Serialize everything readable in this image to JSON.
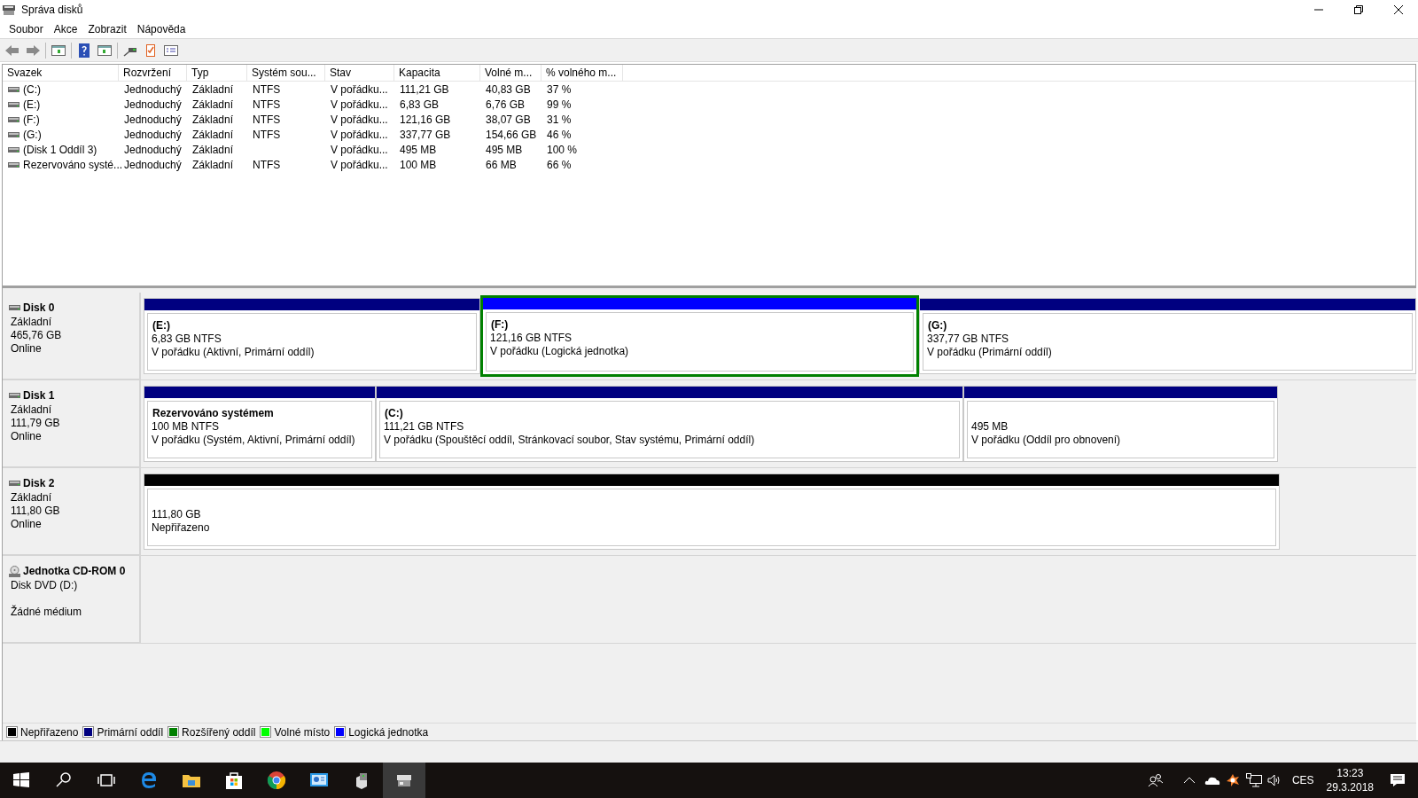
{
  "window": {
    "title": "Správa disků"
  },
  "menu": [
    "Soubor",
    "Akce",
    "Zobrazit",
    "Nápověda"
  ],
  "volume_table": {
    "columns": [
      "Svazek",
      "Rozvržení",
      "Typ",
      "Systém sou...",
      "Stav",
      "Kapacita",
      "Volné m...",
      "% volného m..."
    ],
    "rows": [
      [
        "(C:)",
        "Jednoduchý",
        "Základní",
        "NTFS",
        "V pořádku...",
        "111,21 GB",
        "40,83 GB",
        "37 %"
      ],
      [
        "(E:)",
        "Jednoduchý",
        "Základní",
        "NTFS",
        "V pořádku...",
        "6,83 GB",
        "6,76 GB",
        "99 %"
      ],
      [
        "(F:)",
        "Jednoduchý",
        "Základní",
        "NTFS",
        "V pořádku...",
        "121,16 GB",
        "38,07 GB",
        "31 %"
      ],
      [
        "(G:)",
        "Jednoduchý",
        "Základní",
        "NTFS",
        "V pořádku...",
        "337,77 GB",
        "154,66 GB",
        "46 %"
      ],
      [
        "(Disk 1 Oddíl 3)",
        "Jednoduchý",
        "Základní",
        "",
        "V pořádku...",
        "495 MB",
        "495 MB",
        "100 %"
      ],
      [
        "Rezervováno systé...",
        "Jednoduchý",
        "Základní",
        "NTFS",
        "V pořádku...",
        "100 MB",
        "66 MB",
        "66 %"
      ]
    ]
  },
  "disks": [
    {
      "name": "Disk 0",
      "kind": "disk",
      "lines": [
        "Základní",
        "465,76 GB",
        "Online"
      ],
      "partitions": [
        {
          "kind": "primary",
          "selected": false,
          "title": "(E:)",
          "lines": [
            "6,83 GB NTFS",
            "V pořádku (Aktivní, Primární oddíl)"
          ]
        },
        {
          "kind": "logical",
          "selected": true,
          "title": "(F:)",
          "lines": [
            "121,16 GB NTFS",
            "V pořádku (Logická jednotka)"
          ]
        },
        {
          "kind": "primary",
          "selected": false,
          "title": "(G:)",
          "lines": [
            "337,77 GB NTFS",
            "V pořádku (Primární oddíl)"
          ]
        }
      ]
    },
    {
      "name": "Disk 1",
      "kind": "disk",
      "lines": [
        "Základní",
        "111,79 GB",
        "Online"
      ],
      "partitions": [
        {
          "kind": "primary",
          "selected": false,
          "title": "Rezervováno systémem",
          "lines": [
            "100 MB NTFS",
            "V pořádku (Systém, Aktivní, Primární oddíl)"
          ]
        },
        {
          "kind": "primary",
          "selected": false,
          "title": "(C:)",
          "lines": [
            "111,21 GB NTFS",
            "V pořádku (Spouštěcí oddíl, Stránkovací soubor, Stav systému, Primární oddíl)"
          ]
        },
        {
          "kind": "primary",
          "selected": false,
          "lines": [
            "495 MB",
            "V pořádku (Oddíl pro obnovení)"
          ]
        }
      ]
    },
    {
      "name": "Disk 2",
      "kind": "disk",
      "lines": [
        "Základní",
        "111,80 GB",
        "Online"
      ],
      "partitions": [
        {
          "kind": "unallocated",
          "selected": false,
          "lines": [
            "111,80 GB",
            "Nepřiřazeno"
          ]
        }
      ]
    },
    {
      "name": "Jednotka CD-ROM 0",
      "kind": "cdrom",
      "lines": [
        "Disk DVD (D:)",
        "Žádné médium"
      ]
    }
  ],
  "legend": [
    {
      "label": "Nepřiřazeno",
      "color": "#000000"
    },
    {
      "label": "Primární oddíl",
      "color": "#000080"
    },
    {
      "label": "Rozšířený oddíl",
      "color": "#008000"
    },
    {
      "label": "Volné místo",
      "color": "#00ff00"
    },
    {
      "label": "Logická jednotka",
      "color": "#0000ff"
    }
  ],
  "taskbar": {
    "input_language": "CES",
    "time": "13:23",
    "date": "29.3.2018"
  }
}
